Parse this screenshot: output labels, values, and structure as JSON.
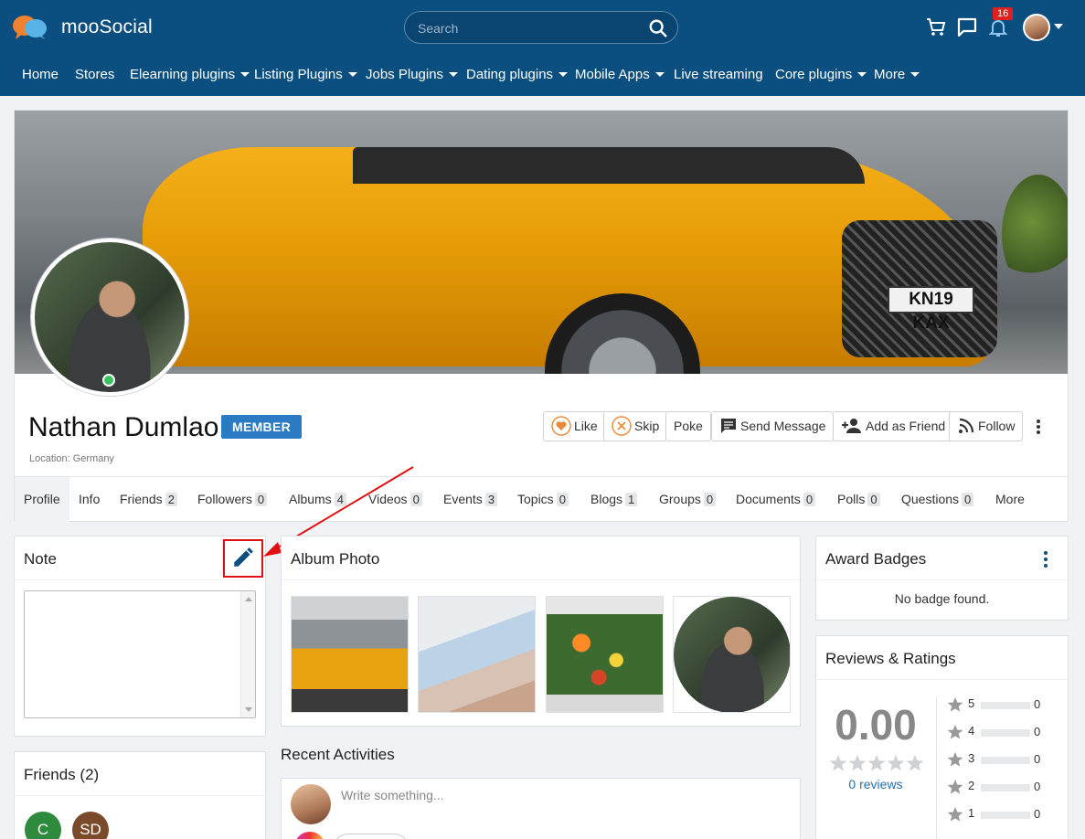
{
  "brand": {
    "name": "mooSocial"
  },
  "search": {
    "placeholder": "Search"
  },
  "header": {
    "notification_count": "16"
  },
  "nav": {
    "items": [
      {
        "label": "Home",
        "dropdown": false
      },
      {
        "label": "Stores",
        "dropdown": false
      },
      {
        "label": "Elearning plugins",
        "dropdown": true
      },
      {
        "label": "Listing Plugins",
        "dropdown": true
      },
      {
        "label": "Jobs Plugins",
        "dropdown": true
      },
      {
        "label": "Dating plugins",
        "dropdown": true
      },
      {
        "label": "Mobile Apps",
        "dropdown": true
      },
      {
        "label": "Live streaming",
        "dropdown": false
      },
      {
        "label": "Core plugins",
        "dropdown": true
      },
      {
        "label": "More",
        "dropdown": true
      }
    ]
  },
  "cover": {
    "plate_text": "KN19 KAX"
  },
  "profile": {
    "name": "Nathan Dumlao",
    "role_badge": "MEMBER",
    "location": "Location: Germany",
    "actions": {
      "like": "Like",
      "skip": "Skip",
      "poke": "Poke",
      "send_message": "Send Message",
      "add_friend": "Add as Friend",
      "follow": "Follow"
    }
  },
  "tabs": [
    {
      "label": "Profile",
      "count": null
    },
    {
      "label": "Info",
      "count": null
    },
    {
      "label": "Friends",
      "count": "2"
    },
    {
      "label": "Followers",
      "count": "0"
    },
    {
      "label": "Albums",
      "count": "4"
    },
    {
      "label": "Videos",
      "count": "0"
    },
    {
      "label": "Events",
      "count": "3"
    },
    {
      "label": "Topics",
      "count": "0"
    },
    {
      "label": "Blogs",
      "count": "1"
    },
    {
      "label": "Groups",
      "count": "0"
    },
    {
      "label": "Documents",
      "count": "0"
    },
    {
      "label": "Polls",
      "count": "0"
    },
    {
      "label": "Questions",
      "count": "0"
    },
    {
      "label": "More",
      "count": null
    }
  ],
  "note": {
    "title": "Note",
    "value": ""
  },
  "friends": {
    "title": "Friends (2)",
    "avatars": [
      {
        "initials": "C",
        "color": "#2e8b3e"
      },
      {
        "initials": "SD",
        "color": "#7a4a2a"
      }
    ]
  },
  "album": {
    "title": "Album Photo"
  },
  "activities": {
    "title": "Recent Activities",
    "placeholder": "Write something..."
  },
  "badges": {
    "title": "Award Badges",
    "empty_text": "No badge found."
  },
  "reviews": {
    "title": "Reviews & Ratings",
    "average": "0.00",
    "review_count_text": "0 reviews",
    "breakdown": [
      {
        "stars": "5",
        "count": "0"
      },
      {
        "stars": "4",
        "count": "0"
      },
      {
        "stars": "3",
        "count": "0"
      },
      {
        "stars": "2",
        "count": "0"
      },
      {
        "stars": "1",
        "count": "0"
      }
    ]
  },
  "colors": {
    "header_bg": "#0a4f7f",
    "badge_blue": "#2a7bc4",
    "highlight_red": "#e01010",
    "online_green": "#3cc35f"
  }
}
